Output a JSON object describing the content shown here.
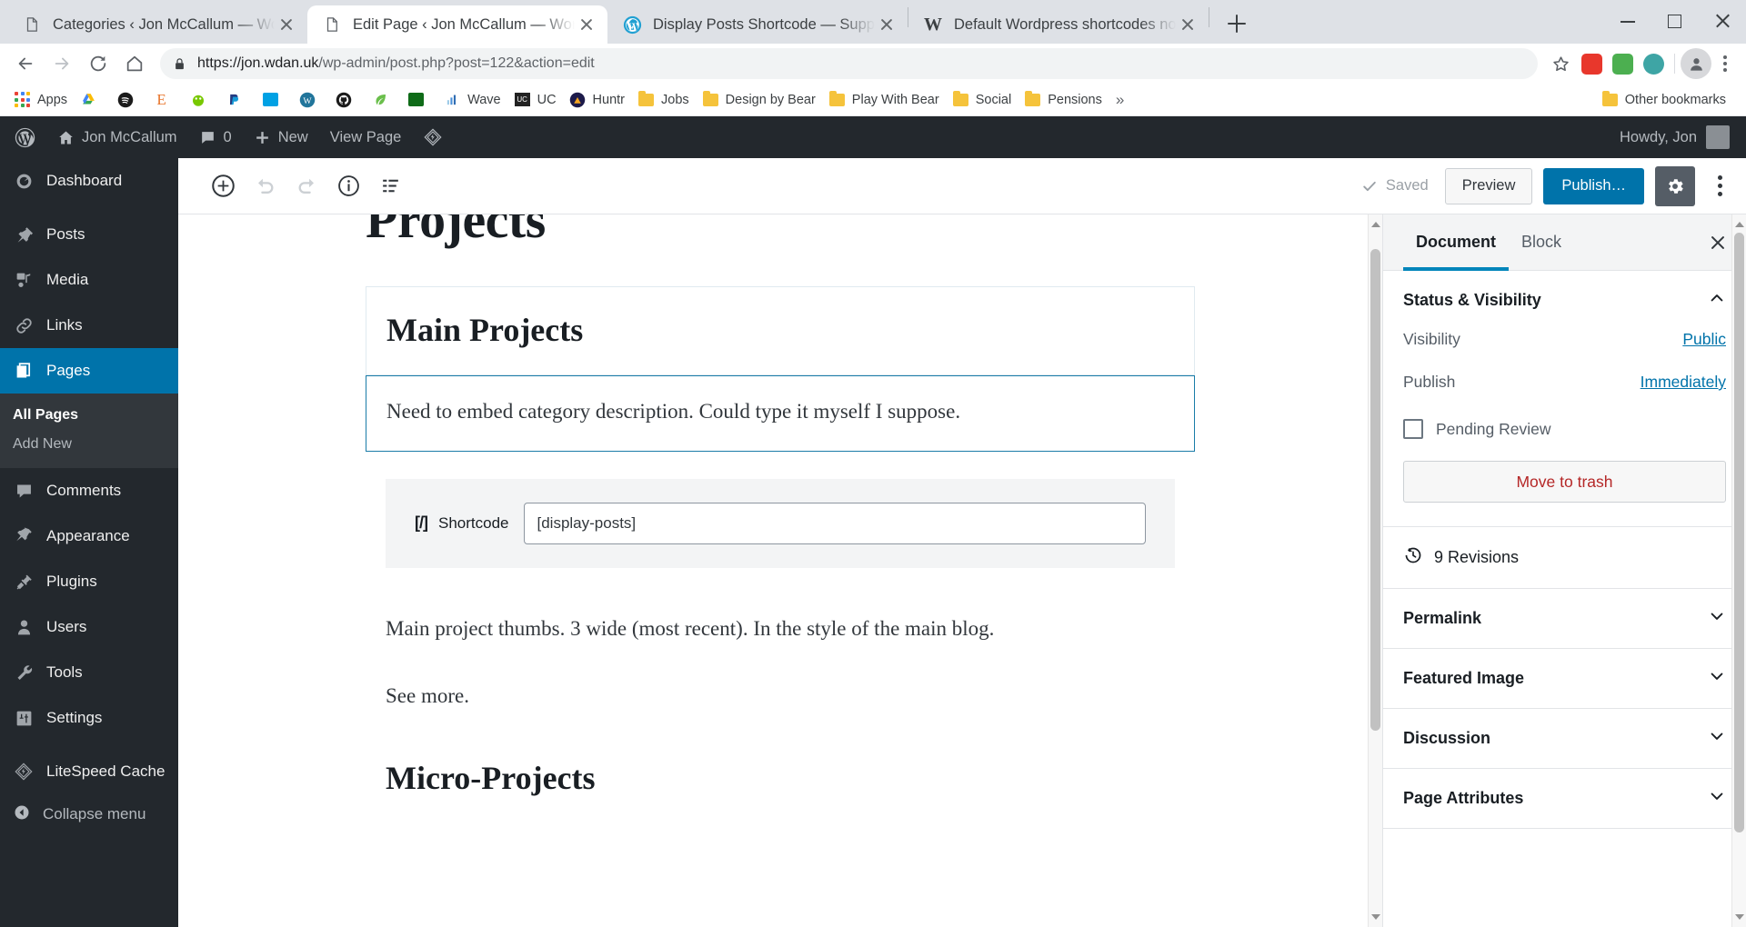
{
  "browser": {
    "tabs": [
      {
        "title": "Categories ‹ Jon McCallum — Wo",
        "favicon": "page-icon",
        "active": false
      },
      {
        "title": "Edit Page ‹ Jon McCallum — Wor",
        "favicon": "page-icon",
        "active": true
      },
      {
        "title": "Display Posts Shortcode — Supp",
        "favicon": "wordpress-icon",
        "active": false
      },
      {
        "title": "Default Wordpress shortcodes no",
        "favicon": "w-icon",
        "active": false
      }
    ],
    "newtab_label": "+",
    "window_controls": {
      "minimize": "minimize-icon",
      "maximize": "maximize-icon",
      "close": "close-icon"
    },
    "nav": {
      "back": "back-arrow-icon",
      "forward": "forward-arrow-icon",
      "reload": "reload-icon",
      "home": "home-icon",
      "lock": "lock-icon",
      "url_prefix": "https://jon.wdan.uk",
      "url_suffix": "/wp-admin/post.php?post=122&action=edit",
      "star": "bookmark-star-icon",
      "profile": "profile-avatar-icon",
      "menu": "browser-menu-icon",
      "extensions": [
        "mdm-extension-icon",
        "green-extension-icon",
        "spiral-extension-icon"
      ]
    },
    "bookmarks": {
      "apps_label": "Apps",
      "items": [
        {
          "label": "",
          "icon": "google-drive-icon",
          "color": "#3d8b40"
        },
        {
          "label": "",
          "icon": "spotify-icon",
          "color": "#1b1b1b"
        },
        {
          "label": "",
          "icon": "e-icon",
          "color": "#e8762d"
        },
        {
          "label": "",
          "icon": "duolingo-icon",
          "color": "#78c800"
        },
        {
          "label": "",
          "icon": "paypal-icon",
          "color": "#253b80"
        },
        {
          "label": "",
          "icon": "blue-icon",
          "color": "#00a1e4"
        },
        {
          "label": "",
          "icon": "wordpress-icon",
          "color": "#21759b"
        },
        {
          "label": "",
          "icon": "github-icon",
          "color": "#1b1b1b"
        },
        {
          "label": "",
          "icon": "leaf-icon",
          "color": "#6abf4b"
        },
        {
          "label": "",
          "icon": "android-icon",
          "color": "#0f6b18"
        },
        {
          "label": "Wave",
          "icon": "wave-icon",
          "color": "#4a90d9"
        },
        {
          "label": "UC",
          "icon": "uc-icon",
          "color": "#222222"
        },
        {
          "label": "Huntr",
          "icon": "huntr-icon",
          "color": "#1d1b4a"
        },
        {
          "label": "Jobs",
          "icon": "folder-icon",
          "color": "#f5c33b"
        },
        {
          "label": "Design by Bear",
          "icon": "folder-icon",
          "color": "#f5c33b"
        },
        {
          "label": "Play With Bear",
          "icon": "folder-icon",
          "color": "#f5c33b"
        },
        {
          "label": "Social",
          "icon": "folder-icon",
          "color": "#f5c33b"
        },
        {
          "label": "Pensions",
          "icon": "folder-icon",
          "color": "#f5c33b"
        }
      ],
      "overflow": "»",
      "other_bookmarks": "Other bookmarks"
    }
  },
  "wp_adminbar": {
    "logo": "wordpress-logo-icon",
    "site_name": "Jon McCallum",
    "comments_count": "0",
    "new_label": "New",
    "view_page_label": "View Page",
    "litespeed_icon": "litespeed-icon",
    "howdy": "Howdy, Jon"
  },
  "admin_menu": {
    "items": [
      {
        "label": "Dashboard",
        "icon": "dashboard-icon",
        "current": false
      },
      {
        "label": "Posts",
        "icon": "pin-icon",
        "current": false
      },
      {
        "label": "Media",
        "icon": "media-icon",
        "current": false
      },
      {
        "label": "Links",
        "icon": "link-icon",
        "current": false
      },
      {
        "label": "Pages",
        "icon": "pages-icon",
        "current": true
      },
      {
        "label": "Comments",
        "icon": "comment-icon",
        "current": false
      },
      {
        "label": "Appearance",
        "icon": "appearance-icon",
        "current": false
      },
      {
        "label": "Plugins",
        "icon": "plugin-icon",
        "current": false
      },
      {
        "label": "Users",
        "icon": "users-icon",
        "current": false
      },
      {
        "label": "Tools",
        "icon": "tools-icon",
        "current": false
      },
      {
        "label": "Settings",
        "icon": "settings-icon",
        "current": false
      },
      {
        "label": "LiteSpeed Cache",
        "icon": "litespeed-icon",
        "current": false
      }
    ],
    "submenu": [
      {
        "label": "All Pages",
        "current": true
      },
      {
        "label": "Add New",
        "current": false
      }
    ],
    "collapse_label": "Collapse menu",
    "collapse_icon": "collapse-arrow-icon"
  },
  "editor_toolbar": {
    "add_block": "add-block-icon",
    "undo": "undo-icon",
    "redo": "redo-icon",
    "info": "content-info-icon",
    "block_nav": "block-navigation-icon",
    "saved_label": "Saved",
    "saved_icon": "check-icon",
    "preview_label": "Preview",
    "publish_label": "Publish…",
    "settings_gear": "gear-icon",
    "more_menu": "kebab-menu-icon"
  },
  "canvas": {
    "page_title": "Projects",
    "blocks": [
      {
        "type": "heading",
        "text": "Main Projects"
      },
      {
        "type": "paragraph",
        "text": "Need to embed category description. Could type it myself I suppose.",
        "selected": true
      },
      {
        "type": "shortcode",
        "label": "Shortcode",
        "icon": "shortcode-icon",
        "value": "[display-posts]"
      },
      {
        "type": "paragraph",
        "text": "Main project thumbs. 3 wide (most recent). In the style of the main blog."
      },
      {
        "type": "paragraph",
        "text": "See more."
      },
      {
        "type": "heading",
        "text": "Micro-Projects"
      }
    ]
  },
  "sidebar": {
    "tabs": [
      {
        "label": "Document",
        "active": true
      },
      {
        "label": "Block",
        "active": false
      }
    ],
    "close_icon": "close-icon",
    "status_panel": {
      "title": "Status & Visibility",
      "chevron": "chevron-up-icon",
      "visibility_label": "Visibility",
      "visibility_value": "Public",
      "publish_label": "Publish",
      "publish_value": "Immediately",
      "pending_review_label": "Pending Review",
      "pending_review_checked": false,
      "trash_label": "Move to trash"
    },
    "revisions": {
      "label": "9 Revisions",
      "icon": "revision-clock-icon"
    },
    "panels": [
      {
        "title": "Permalink",
        "chevron": "chevron-down-icon"
      },
      {
        "title": "Featured Image",
        "chevron": "chevron-down-icon"
      },
      {
        "title": "Discussion",
        "chevron": "chevron-down-icon"
      },
      {
        "title": "Page Attributes",
        "chevron": "chevron-down-icon"
      }
    ]
  },
  "colors": {
    "wp_blue": "#0073aa",
    "wp_dark": "#23282d",
    "wp_submenu": "#32373c",
    "accent_blue": "#0085ba",
    "trash_red": "#b52727"
  }
}
